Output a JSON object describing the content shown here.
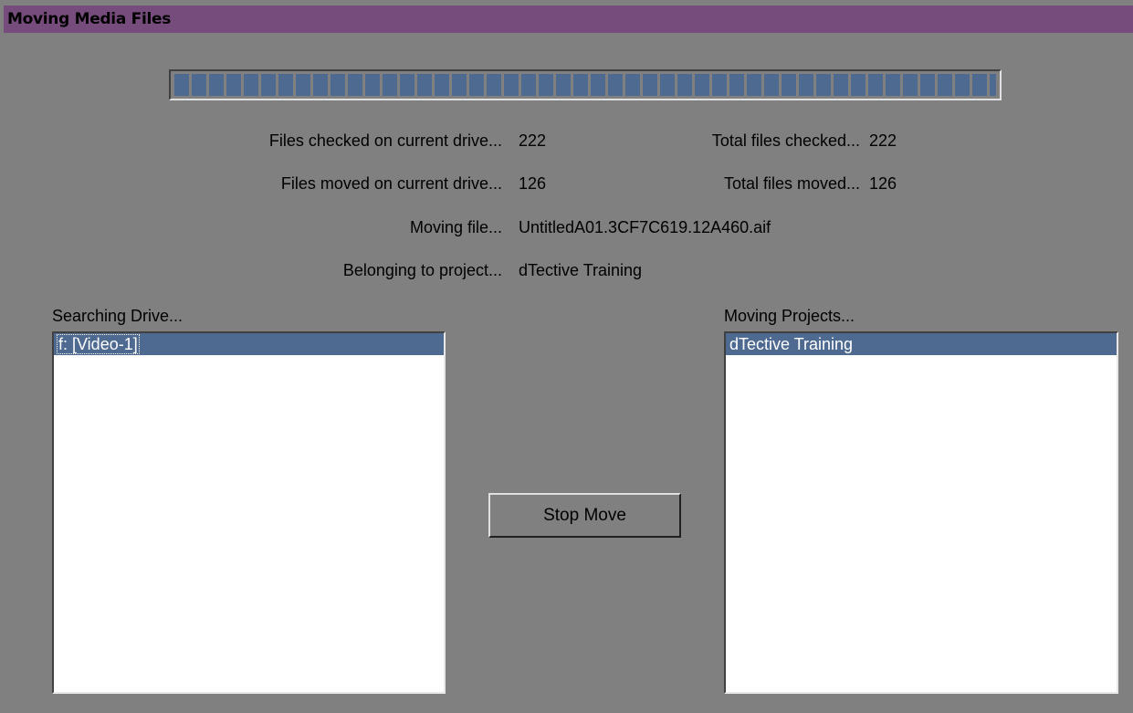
{
  "window": {
    "title": "Moving Media Files"
  },
  "progress": {
    "fraction": 1.0
  },
  "stats": {
    "files_checked_label": "Files checked on current drive...",
    "files_checked_value": "222",
    "total_checked_label": "Total files checked...",
    "total_checked_value": "222",
    "files_moved_label": "Files moved on current drive...",
    "files_moved_value": "126",
    "total_moved_label": "Total files moved...",
    "total_moved_value": "126",
    "moving_file_label": "Moving file...",
    "moving_file_value": "UntitledA01.3CF7C619.12A460.aif",
    "project_label": "Belonging to project...",
    "project_value": "dTective Training"
  },
  "drives": {
    "label": "Searching Drive...",
    "items": [
      "f: [Video-1]"
    ]
  },
  "projects": {
    "label": "Moving Projects...",
    "items": [
      "dTective Training"
    ]
  },
  "stop_button": {
    "label": "Stop Move"
  },
  "colors": {
    "title_bar": "#764c7c",
    "background": "#808080",
    "selection": "#4f6a90"
  }
}
